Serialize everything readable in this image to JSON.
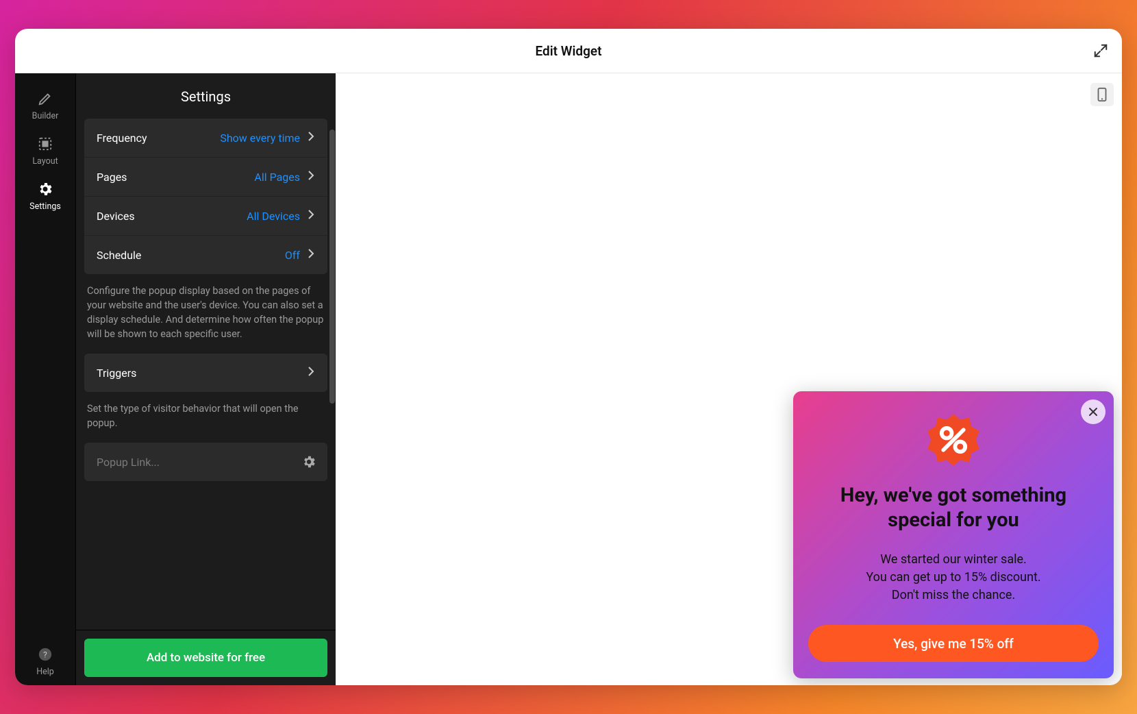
{
  "window": {
    "title": "Edit Widget"
  },
  "rail": {
    "builder": "Builder",
    "layout": "Layout",
    "settings": "Settings",
    "help": "Help"
  },
  "panel": {
    "title": "Settings",
    "rows": {
      "frequency": {
        "label": "Frequency",
        "value": "Show every time"
      },
      "pages": {
        "label": "Pages",
        "value": "All Pages"
      },
      "devices": {
        "label": "Devices",
        "value": "All Devices"
      },
      "schedule": {
        "label": "Schedule",
        "value": "Off"
      }
    },
    "display_desc": "Configure the popup display based on the pages of your website and the user's device. You can also set a display schedule. And determine how often the popup will be shown to each specific user.",
    "triggers": {
      "label": "Triggers"
    },
    "triggers_desc": "Set the type of visitor behavior that will open the popup.",
    "popup_link_placeholder": "Popup Link...",
    "cta": "Add to website for free"
  },
  "popup": {
    "heading": "Hey, we've got something special for you",
    "body_l1": "We started our winter sale.",
    "body_l2": "You can get up to 15% discount.",
    "body_l3": "Don't miss the chance.",
    "button": "Yes, give me 15% off"
  }
}
